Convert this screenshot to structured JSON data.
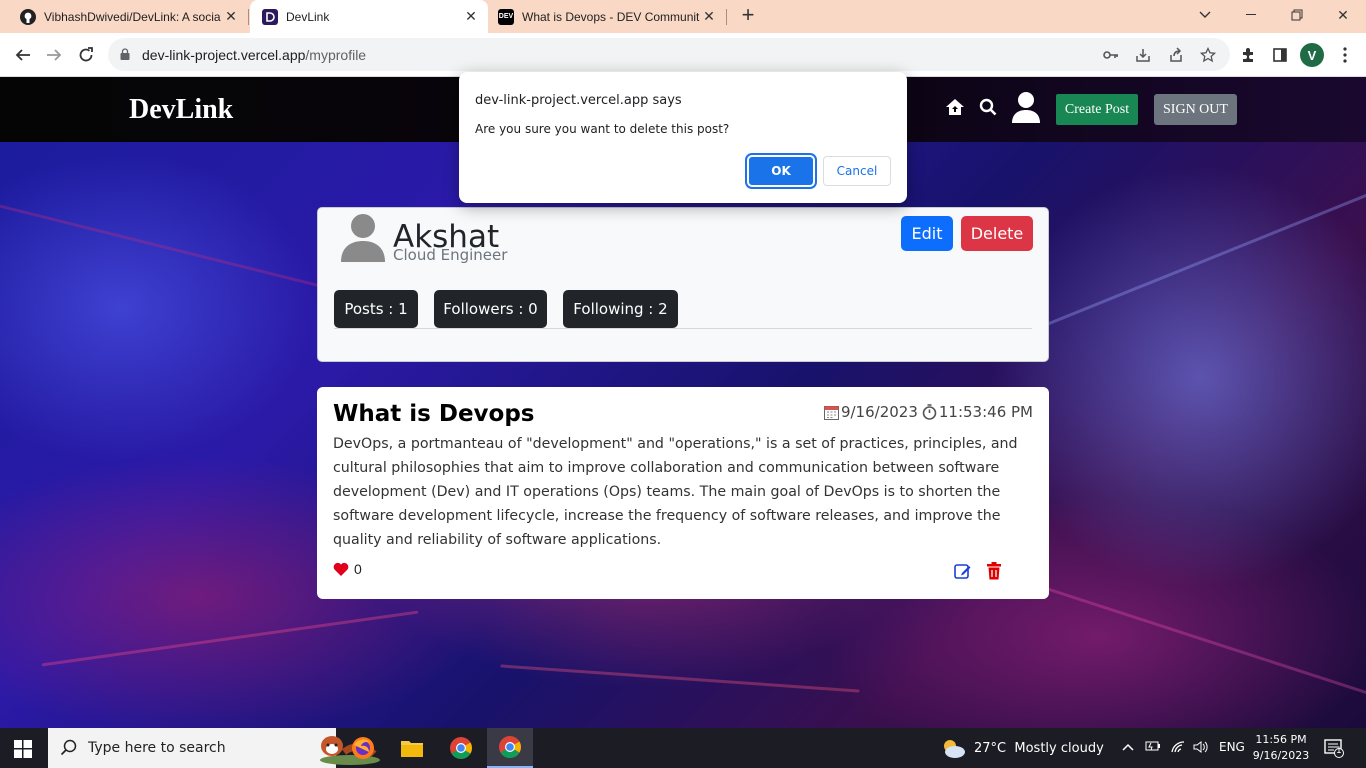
{
  "browser": {
    "tabs": [
      {
        "title": "VibhashDwivedi/DevLink: A socia",
        "favicon": "github-icon",
        "active": false
      },
      {
        "title": "DevLink",
        "favicon": "devlink-icon",
        "active": true
      },
      {
        "title": "What is Devops - DEV Communit",
        "favicon": "dev-icon",
        "active": false
      }
    ],
    "url_host": "dev-link-project.vercel.app",
    "url_path": "/myprofile",
    "profile_initial": "V"
  },
  "navbar": {
    "brand": "DevLink",
    "create_post": "Create Post",
    "sign_out": "SIGN OUT"
  },
  "profile": {
    "name": "Akshat",
    "role": "Cloud Engineer",
    "edit_label": "Edit",
    "delete_label": "Delete",
    "stats": {
      "posts": "Posts : 1",
      "followers": "Followers : 0",
      "following": "Following : 2"
    }
  },
  "post": {
    "title": "What is Devops",
    "date": "9/16/2023",
    "time": "11:53:46 PM",
    "body": "DevOps, a portmanteau of \"development\" and \"operations,\" is a set of practices, principles, and cultural philosophies that aim to improve collaboration and communication between software development (Dev) and IT operations (Ops) teams. The main goal of DevOps is to shorten the software development lifecycle, increase the frequency of software releases, and improve the quality and reliability of software applications.",
    "likes": "0"
  },
  "dialog": {
    "title": "dev-link-project.vercel.app says",
    "message": "Are you sure you want to delete this post?",
    "ok": "OK",
    "cancel": "Cancel"
  },
  "taskbar": {
    "search_placeholder": "Type here to search",
    "weather": "27°C  Mostly cloudy",
    "language": "ENG",
    "time": "11:56 PM",
    "date": "9/16/2023",
    "notification_count": "1"
  },
  "colors": {
    "create_post": "#198754",
    "edit": "#0d6efd",
    "delete": "#dc3545",
    "dialog_ok": "#1a73e8"
  }
}
